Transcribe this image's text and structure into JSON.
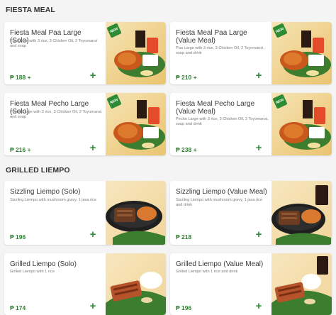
{
  "sections": [
    {
      "title": "FIESTA MEAL"
    },
    {
      "title": "GRILLED LIEMPO"
    }
  ],
  "items": [
    {
      "name": "Fiesta Meal Paa Large (Solo)",
      "desc": "Paa Large with 3 rice, 3 Chicken Oil, 2 Toyomansi and soup",
      "price": "₱ 188 +",
      "badge": "NEW",
      "photo": "chicken-meal-photo"
    },
    {
      "name": "Fiesta Meal Paa Large (Value Meal)",
      "desc": "Paa Large with 3 rice, 3 Chicken Oil, 2 Toyomansi, soup and drink",
      "price": "₱ 210 +",
      "badge": "NEW",
      "photo": "chicken-meal-photo"
    },
    {
      "name": "Fiesta Meal Pecho Large (Solo)",
      "desc": "Pecho Large with 3 rice, 3 Chicken Oil, 2 Toyomansi and soup",
      "price": "₱ 216 +",
      "badge": "NEW",
      "photo": "chicken-meal-photo"
    },
    {
      "name": "Fiesta Meal Pecho Large (Value Meal)",
      "desc": "Pecho Large with 3 rice, 3 Chicken Oil, 2 Toyomansi, soup and drink",
      "price": "₱ 238 +",
      "badge": "NEW",
      "photo": "chicken-meal-photo"
    },
    {
      "name": "Sizzling Liempo (Solo)",
      "desc": "Sizzling Liempo with mushroom gravy, 1 java rice",
      "price": "₱ 196",
      "photo": "sizzling-liempo-photo"
    },
    {
      "name": "Sizzling Liempo (Value Meal)",
      "desc": "Sizzling Liempo with mushroom gravy, 1 java rice and drink",
      "price": "₱ 218",
      "photo": "sizzling-liempo-photo"
    },
    {
      "name": "Grilled Liempo (Solo)",
      "desc": "Grilled Liempo with 1 rice",
      "price": "₱ 174",
      "photo": "grilled-liempo-photo"
    },
    {
      "name": "Grilled Liempo (Value Meal)",
      "desc": "Grilled Liempo with 1 rice and drink",
      "price": "₱ 196",
      "photo": "grilled-liempo-photo"
    }
  ],
  "add_label": "+",
  "colors": {
    "price": "#2f7d32",
    "add": "#2e8b35",
    "badge": "#2e8b35"
  }
}
